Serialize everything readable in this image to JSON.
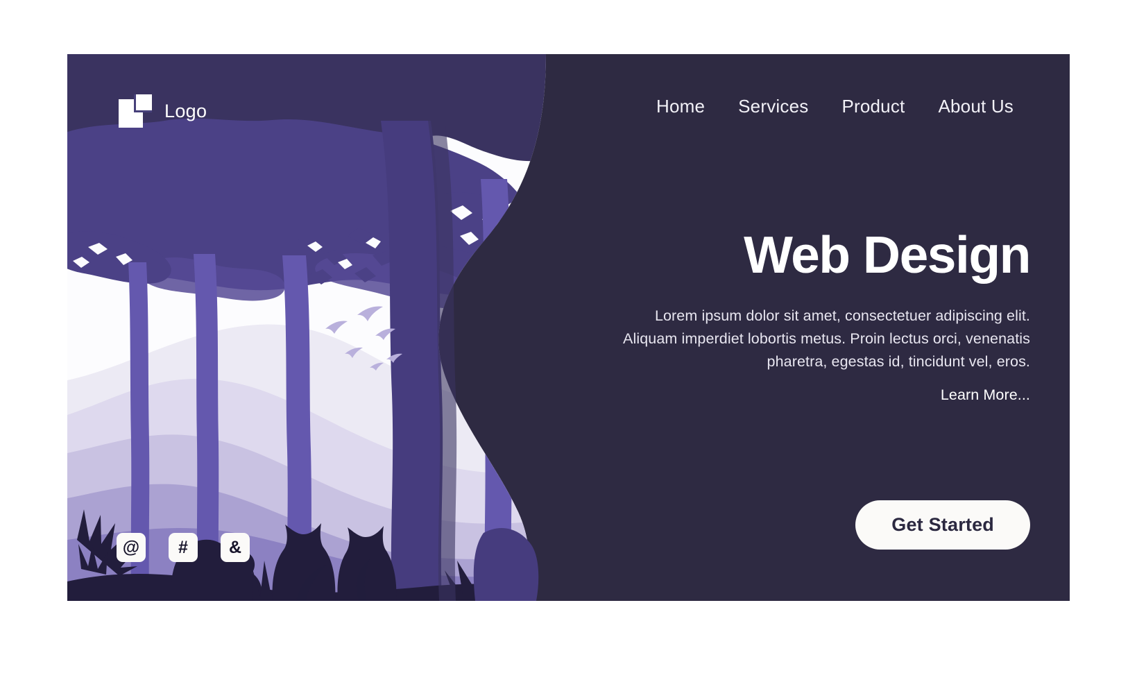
{
  "brand": {
    "logo_text": "Logo",
    "logo_icon": "offset-squares-logo-icon"
  },
  "nav": {
    "items": [
      {
        "label": "Home"
      },
      {
        "label": "Services"
      },
      {
        "label": "Product"
      },
      {
        "label": "About Us"
      }
    ]
  },
  "hero": {
    "headline": "Web Design",
    "body": "Lorem ipsum dolor sit amet, consectetuer adipiscing elit. Aliquam imperdiet lobortis metus. Proin lectus orci, venenatis pharetra, egestas id, tincidunt vel, eros.",
    "learn_more": "Learn More...",
    "cta_label": "Get Started"
  },
  "social": {
    "items": [
      {
        "glyph": "@",
        "icon": "at-sign-icon"
      },
      {
        "glyph": "#",
        "icon": "hash-icon"
      },
      {
        "glyph": "&",
        "icon": "ampersand-icon"
      }
    ]
  },
  "colors": {
    "page_background": "#ffffff",
    "hero_background": "#2e2a42",
    "foliage_purple": "#5b4f9e",
    "canopy_dark": "#4a4180",
    "trunk_purple": "#6458ae",
    "mountain_light": "#eceaf4",
    "mountain_mid": "#d6d2e8",
    "mountain_dark": "#b3acd6",
    "mountain_deep": "#8d83c0",
    "silhouette": "#221d3c",
    "text_primary": "#ffffff",
    "cta_background": "#fbfaf8",
    "cta_text": "#2b2840"
  },
  "illustration": {
    "name": "forest-landscape-illustration",
    "description": "Flat-style purple forest at night: dark sky, layered canopy, tall tree trunks, lavender mountain ridges, flying birds, animal and fern silhouettes"
  }
}
